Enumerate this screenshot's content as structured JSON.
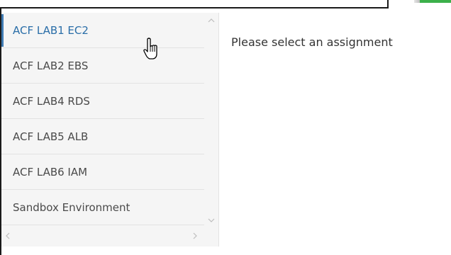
{
  "sidebar": {
    "items": [
      {
        "label": "ACF LAB1 EC2",
        "active": true
      },
      {
        "label": "ACF LAB2 EBS",
        "active": false
      },
      {
        "label": "ACF LAB4 RDS",
        "active": false
      },
      {
        "label": "ACF LAB5 ALB",
        "active": false
      },
      {
        "label": "ACF LAB6 IAM",
        "active": false
      },
      {
        "label": "Sandbox Environment",
        "active": false
      }
    ],
    "scroll_up_icon": "chevron-up-icon",
    "scroll_down_icon": "chevron-down-icon",
    "scroll_left_icon": "chevron-left-icon",
    "scroll_right_icon": "chevron-right-icon"
  },
  "content": {
    "message": "Please select an assignment"
  },
  "colors": {
    "active_text": "#2a6ea8",
    "active_bar": "#3f7bb3",
    "sidebar_bg": "#f5f5f5",
    "accent_green": "#3cb04a"
  },
  "cursor_icon": "hand-pointer-icon"
}
